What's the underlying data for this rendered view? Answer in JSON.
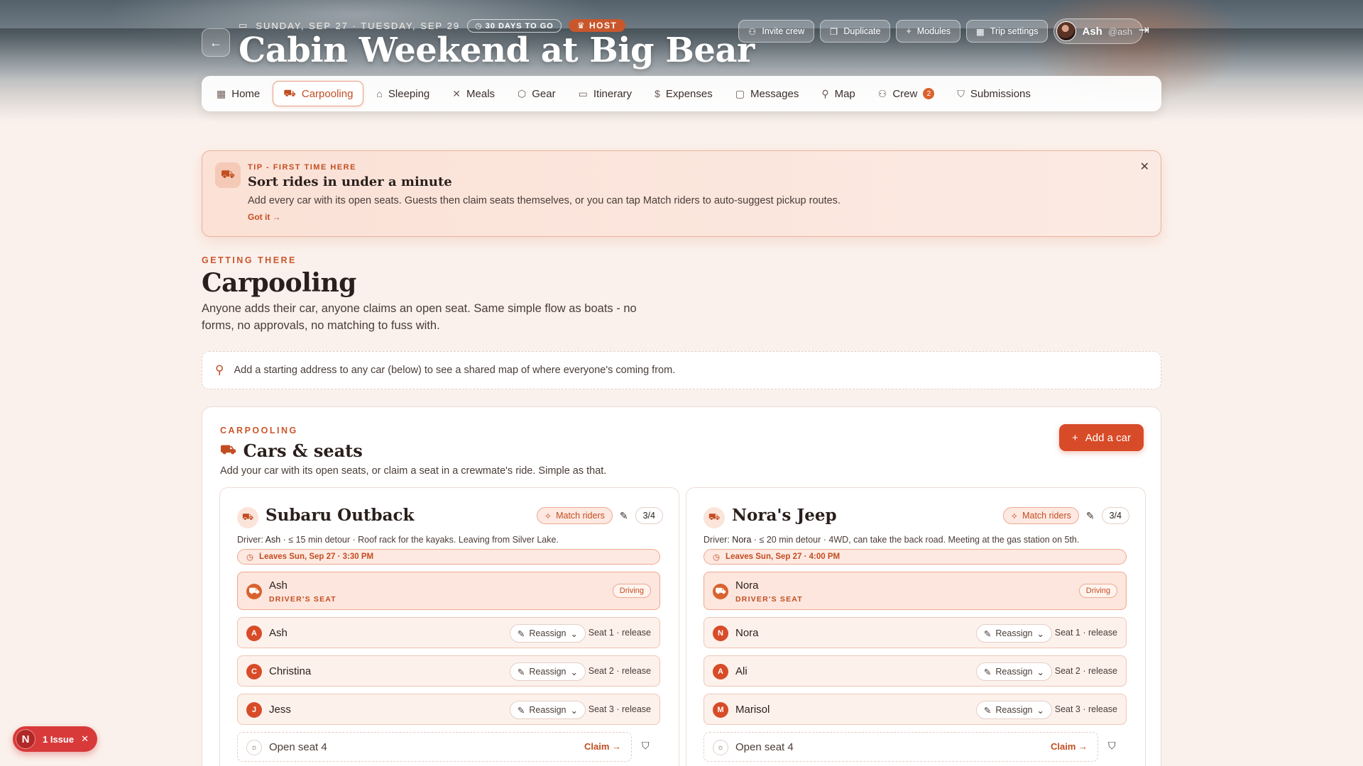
{
  "trip": {
    "dates": "SUNDAY, SEP 27 · TUESDAY, SEP 29",
    "countdown": "30 DAYS TO GO",
    "role": "HOST",
    "title": "Cabin Weekend at Big Bear"
  },
  "top_actions": {
    "invite": "Invite crew",
    "duplicate": "Duplicate",
    "modules": "Modules",
    "settings": "Trip settings"
  },
  "user": {
    "name": "Ash",
    "handle": "@ash"
  },
  "tabs": [
    {
      "label": "Home",
      "icon": "grid-icon"
    },
    {
      "label": "Carpooling",
      "icon": "car-icon",
      "active": true
    },
    {
      "label": "Sleeping",
      "icon": "bed-icon"
    },
    {
      "label": "Meals",
      "icon": "utensils-icon"
    },
    {
      "label": "Gear",
      "icon": "package-icon"
    },
    {
      "label": "Itinerary",
      "icon": "calendar-icon"
    },
    {
      "label": "Expenses",
      "icon": "dollar-icon"
    },
    {
      "label": "Messages",
      "icon": "message-icon"
    },
    {
      "label": "Map",
      "icon": "pin-icon"
    },
    {
      "label": "Crew",
      "icon": "users-icon",
      "badge": "2"
    },
    {
      "label": "Submissions",
      "icon": "shield-icon"
    }
  ],
  "tip": {
    "eyebrow": "TIP - FIRST TIME HERE",
    "title": "Sort rides in under a minute",
    "body": "Add every car with its open seats. Guests then claim seats themselves, or you can tap Match riders to auto-suggest pickup routes.",
    "link": "Got it →"
  },
  "page": {
    "eyebrow": "GETTING THERE",
    "title": "Carpooling",
    "description": "Anyone adds their car, anyone claims an open seat. Same simple flow as boats - no forms, no approvals, no matching to fuss with.",
    "map_note": "Add a starting address to any car (below) to see a shared map of where everyone's coming from."
  },
  "cars_panel": {
    "eyebrow": "CARPOOLING",
    "title": "Cars & seats",
    "description": "Add your car with its open seats, or claim a seat in a crewmate's ride. Simple as that.",
    "add_button": "Add a car",
    "match_label": "Match riders",
    "driver_prefix": "Driver:",
    "driver_seat_label": "DRIVER'S SEAT",
    "driving_label": "Driving",
    "reassign_label": "Reassign",
    "claim_label": "Claim →"
  },
  "cars": [
    {
      "name": "Subaru Outback",
      "capacity": "3/4",
      "driver": "Ash",
      "details": " · ≤ 15 min detour · Roof rack for the kayaks. Leaving from Silver Lake.",
      "leaves": "Leaves Sun, Sep 27 · 3:30 PM",
      "driver_name": "Ash",
      "seats": [
        {
          "initial": "A",
          "name": "Ash",
          "meta": "Seat 1 · release"
        },
        {
          "initial": "C",
          "name": "Christina",
          "meta": "Seat 2 · release"
        },
        {
          "initial": "J",
          "name": "Jess",
          "meta": "Seat 3 · release"
        }
      ],
      "open_seat": "Open seat 4"
    },
    {
      "name": "Nora's Jeep",
      "capacity": "3/4",
      "driver": "Nora",
      "details": " · ≤ 20 min detour · 4WD, can take the back road. Meeting at the gas station on 5th.",
      "leaves": "Leaves Sun, Sep 27 · 4:00 PM",
      "driver_name": "Nora",
      "seats": [
        {
          "initial": "N",
          "name": "Nora",
          "meta": "Seat 1 · release"
        },
        {
          "initial": "A",
          "name": "Ali",
          "meta": "Seat 2 · release"
        },
        {
          "initial": "M",
          "name": "Marisol",
          "meta": "Seat 3 · release"
        }
      ],
      "open_seat": "Open seat 4"
    }
  ],
  "issue_toast": {
    "badge": "N",
    "label": "1 Issue"
  }
}
